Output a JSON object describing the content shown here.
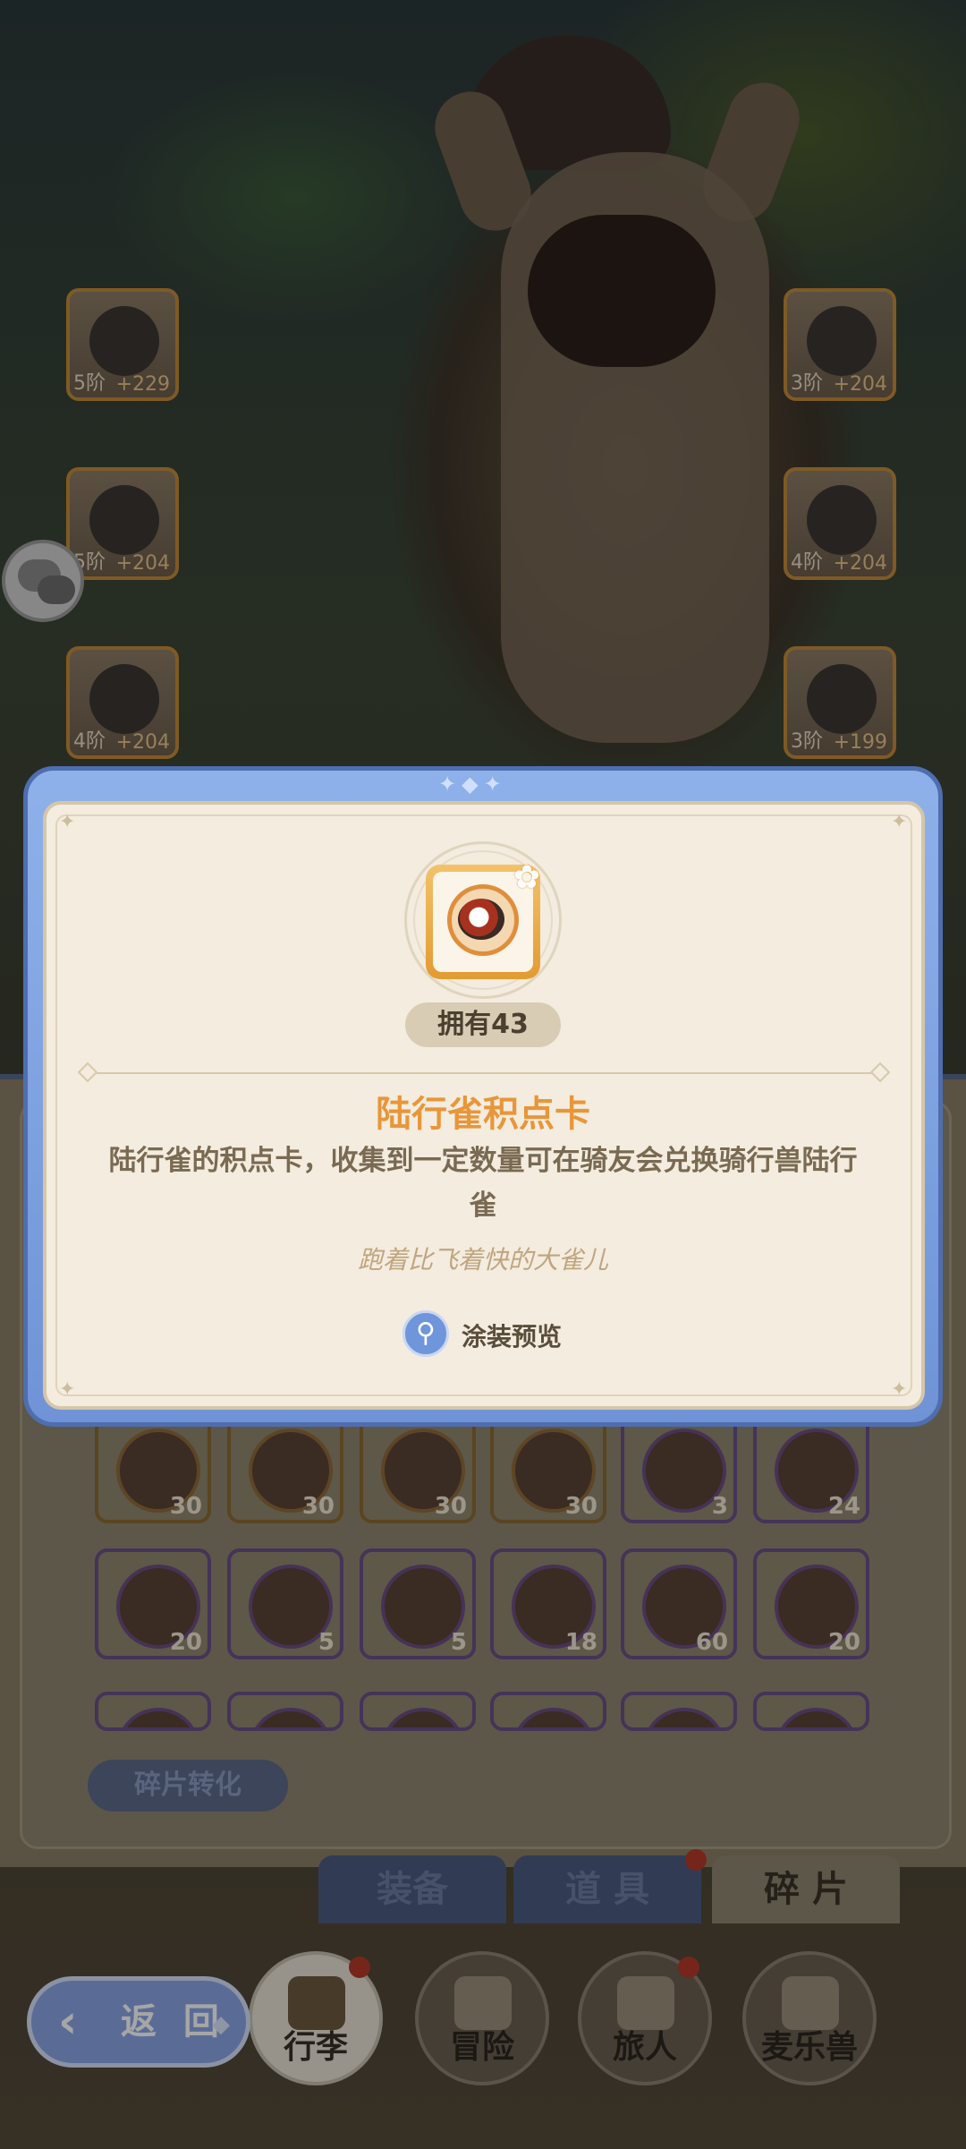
{
  "equipment": [
    {
      "level": "5阶",
      "bonus": "+229"
    },
    {
      "level": "3阶",
      "bonus": "+204"
    },
    {
      "level": "5阶",
      "bonus": "+204"
    },
    {
      "level": "4阶",
      "bonus": "+204"
    },
    {
      "level": "4阶",
      "bonus": "+204"
    },
    {
      "level": "3阶",
      "bonus": "+199"
    }
  ],
  "modal": {
    "owned": "拥有43",
    "title": "陆行雀积点卡",
    "description": "陆行雀的积点卡，收集到一定数量可在骑友会兑换骑行兽陆行雀",
    "flavor": "跑着比飞着快的大雀儿",
    "preview_label": "涂装预览"
  },
  "inventory": {
    "counts": [
      "30",
      "30",
      "30",
      "30",
      "3",
      "24",
      "20",
      "5",
      "5",
      "18",
      "60",
      "20"
    ],
    "convert_button": "碎片转化"
  },
  "tabs": [
    "装备",
    "道 具",
    "碎 片"
  ],
  "nav": {
    "items": [
      "行李",
      "冒险",
      "旅人",
      "麦乐兽"
    ],
    "back_label": "返 回"
  }
}
